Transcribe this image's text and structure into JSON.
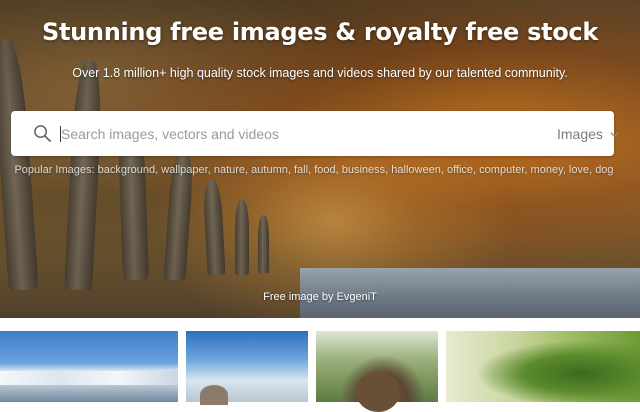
{
  "hero": {
    "title": "Stunning free images & royalty free stock",
    "subtitle": "Over 1.8 million+ high quality stock images and videos shared by our talented community.",
    "credit": "Free image by EvgeniT"
  },
  "search": {
    "placeholder": "Search images, vectors and videos",
    "value": "",
    "type_selected": "Images",
    "icon": "search-icon"
  },
  "popular": {
    "label": "Popular Images:",
    "tags": [
      "background",
      "wallpaper",
      "nature",
      "autumn",
      "fall",
      "food",
      "business",
      "halloween",
      "office",
      "computer",
      "money",
      "love",
      "dog"
    ]
  },
  "thumbnails": [
    "waterfall",
    "rock-sky",
    "person-nature",
    "green-leaf"
  ]
}
